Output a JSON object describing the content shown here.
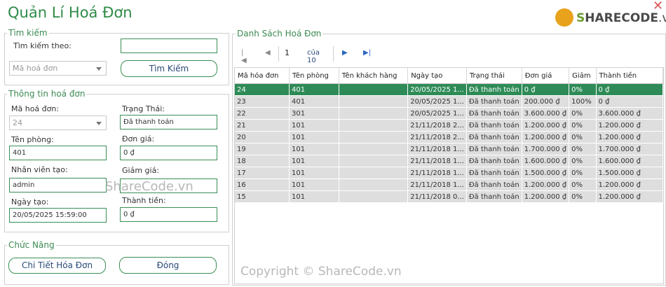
{
  "app": {
    "title": "Quản Lí Hoá Đơn"
  },
  "logo": {
    "prefix": "S",
    "brand": "HARECODE",
    "suffix": ".vn"
  },
  "search": {
    "group_title": "Tìm kiếm",
    "search_by_label": "Tìm kiếm theo:",
    "keyword_value": "",
    "field_combo_value": "Mã hoá đơn",
    "search_button": "Tìm Kiếm"
  },
  "invoice_info": {
    "group_title": "Thông tin hoá đơn",
    "invoice_id_label": "Mã hoá đơn:",
    "invoice_id_value": "24",
    "status_label": "Trạng Thái:",
    "status_value": "Đã thanh toán",
    "room_label": "Tên phòng:",
    "room_value": "401",
    "price_label": "Đơn giá:",
    "price_value": "0 ₫",
    "staff_label": "Nhân viên tạo:",
    "staff_value": "admin",
    "discount_label": "Giảm giá:",
    "discount_value": "",
    "date_label": "Ngày tạo:",
    "date_value": "20/05/2025 15:59:00",
    "total_label": "Thành tiền:",
    "total_value": "0 ₫"
  },
  "functions": {
    "group_title": "Chức Năng",
    "detail_button": "Chi Tiết Hóa Đơn",
    "close_button": "Đóng"
  },
  "list": {
    "group_title": "Danh Sách Hoá Đơn",
    "pager": {
      "current_page": "1",
      "of_label": "của 10"
    },
    "columns": [
      "Mã hóa đơn",
      "Tên phòng",
      "Tên khách hàng",
      "Ngày tạo",
      "Trạng thái",
      "Đơn giá",
      "Giảm",
      "Thành tiền"
    ],
    "rows": [
      [
        "24",
        "401",
        "",
        "20/05/2025 1...",
        "Đã thanh toán",
        "0 ₫",
        "0%",
        "0 ₫"
      ],
      [
        "23",
        "401",
        "",
        "20/05/2025 1...",
        "Đã thanh toán",
        "200.000 ₫",
        "100%",
        "0 ₫"
      ],
      [
        "22",
        "301",
        "",
        "20/05/2025 1...",
        "Đã thanh toán",
        "3.600.000 ₫",
        "0%",
        "3.600.000 ₫"
      ],
      [
        "21",
        "101",
        "",
        "21/11/2018 2...",
        "Đã thanh toán",
        "1.200.000 ₫",
        "0%",
        "1.200.000 ₫"
      ],
      [
        "20",
        "101",
        "",
        "21/11/2018 2...",
        "Đã thanh toán",
        "1.200.000 ₫",
        "0%",
        "1.200.000 ₫"
      ],
      [
        "19",
        "101",
        "",
        "21/11/2018 1...",
        "Đã thanh toán",
        "1.700.000 ₫",
        "0%",
        "1.700.000 ₫"
      ],
      [
        "18",
        "101",
        "",
        "21/11/2018 1...",
        "Đã thanh toán",
        "1.600.000 ₫",
        "0%",
        "1.600.000 ₫"
      ],
      [
        "17",
        "101",
        "",
        "21/11/2018 1...",
        "Đã thanh toán",
        "1.500.000 ₫",
        "0%",
        "1.500.000 ₫"
      ],
      [
        "16",
        "101",
        "",
        "21/11/2018 1...",
        "Đã thanh toán",
        "1.200.000 ₫",
        "0%",
        "1.200.000 ₫"
      ],
      [
        "15",
        "101",
        "",
        "21/11/2018 0...",
        "Đã thanh toán",
        "1.200.000 ₫",
        "0%",
        "1.200.000 ₫"
      ]
    ]
  },
  "watermarks": {
    "center": "ShareCode.vn",
    "footer": "Copyright © ShareCode.vn"
  },
  "colors": {
    "accent": "#2e8b57",
    "selected_row": "#2e8b57",
    "row_bg": "#dedede",
    "border": "#3a8f55"
  }
}
